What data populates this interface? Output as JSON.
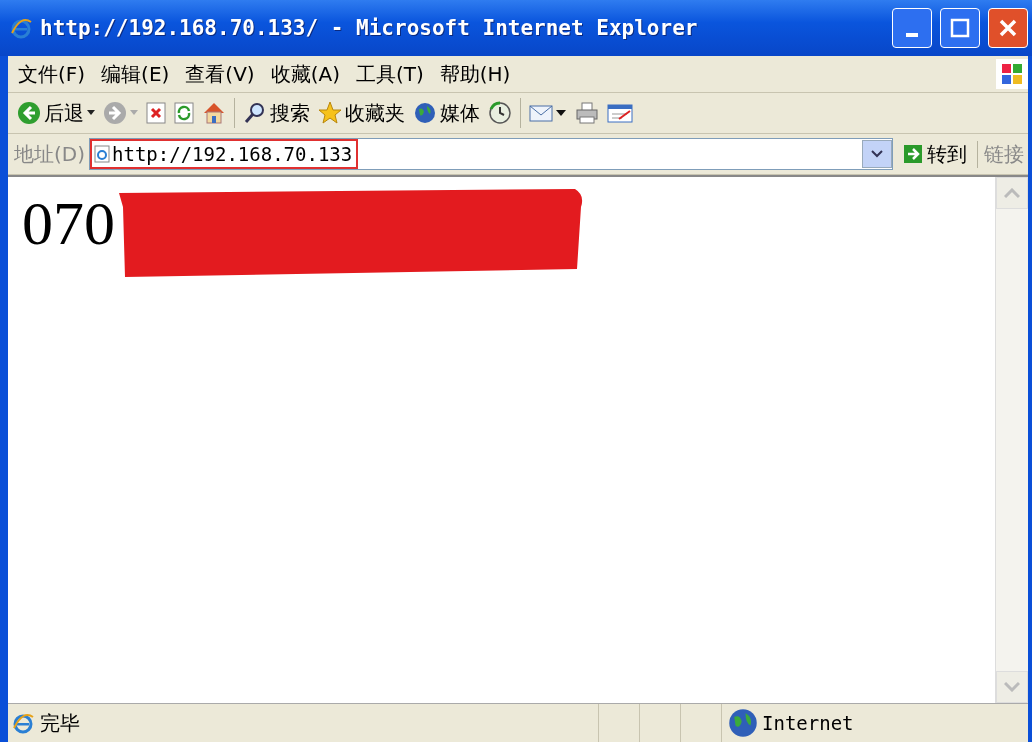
{
  "window": {
    "title": "http://192.168.70.133/ - Microsoft Internet Explorer"
  },
  "menu": [
    "文件(F)",
    "编辑(E)",
    "查看(V)",
    "收藏(A)",
    "工具(T)",
    "帮助(H)"
  ],
  "toolbar": [
    {
      "kind": "back",
      "label": "后退",
      "disabled": false
    },
    {
      "kind": "forward",
      "disabled": true
    },
    {
      "kind": "stop"
    },
    {
      "kind": "refresh"
    },
    {
      "kind": "home"
    },
    {
      "kind": "search",
      "label": "搜索"
    },
    {
      "kind": "favorites",
      "label": "收藏夹"
    },
    {
      "kind": "media",
      "label": "媒体"
    },
    {
      "kind": "history"
    },
    {
      "kind": "mail"
    },
    {
      "kind": "print"
    },
    {
      "kind": "edit"
    }
  ],
  "address": {
    "label": "地址(D)",
    "value": "http://192.168.70.133",
    "highlighted": true,
    "go": "转到",
    "links": "链接"
  },
  "page": {
    "text": "070",
    "redacted": true
  },
  "status": {
    "text": "完毕",
    "zone": "Internet"
  }
}
